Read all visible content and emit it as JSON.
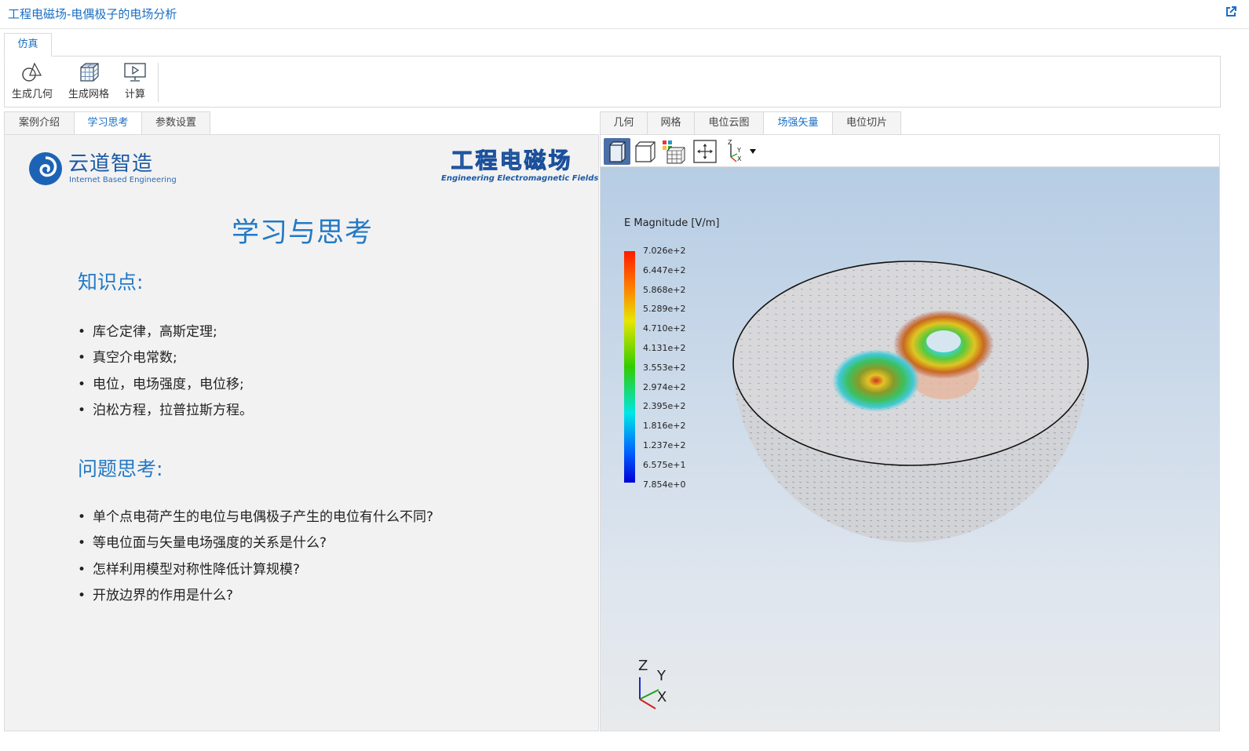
{
  "window": {
    "title": "工程电磁场-电偶极子的电场分析"
  },
  "ribbon": {
    "tab": "仿真",
    "buttons": [
      {
        "label": "生成几何",
        "icon": "geometry-icon"
      },
      {
        "label": "生成网格",
        "icon": "mesh-icon"
      },
      {
        "label": "计算",
        "icon": "compute-icon"
      }
    ]
  },
  "left": {
    "tabs": [
      "案例介绍",
      "学习思考",
      "参数设置"
    ],
    "active_tab": "学习思考",
    "logo": {
      "brand": "云道智造",
      "brand_sub": "Internet Based Engineering",
      "course": "工程电磁场",
      "course_sub": "Engineering Electromagnetic Fields"
    },
    "heading": "学习与思考",
    "knowledge_title": "知识点:",
    "knowledge": [
      "库仑定律，高斯定理;",
      "真空介电常数;",
      "电位，电场强度，电位移;",
      "泊松方程，拉普拉斯方程。"
    ],
    "questions_title": "问题思考:",
    "questions": [
      "单个点电荷产生的电位与电偶极子产生的电位有什么不同?",
      "等电位面与矢量电场强度的关系是什么?",
      "怎样利用模型对称性降低计算规模?",
      "开放边界的作用是什么?"
    ]
  },
  "right": {
    "tabs": [
      "几何",
      "网格",
      "电位云图",
      "场强矢量",
      "电位切片"
    ],
    "active_tab": "场强矢量",
    "legend": {
      "title": "E Magnitude [V/m]",
      "ticks": [
        "7.026e+2",
        "6.447e+2",
        "5.868e+2",
        "5.289e+2",
        "4.710e+2",
        "4.131e+2",
        "3.553e+2",
        "2.974e+2",
        "2.395e+2",
        "1.816e+2",
        "1.237e+2",
        "6.575e+1",
        "7.854e+0"
      ]
    },
    "axes": {
      "z": "Z",
      "y": "Y",
      "x": "X"
    }
  },
  "colors": {
    "accent": "#1a6fc4",
    "heading": "#2379c6"
  }
}
